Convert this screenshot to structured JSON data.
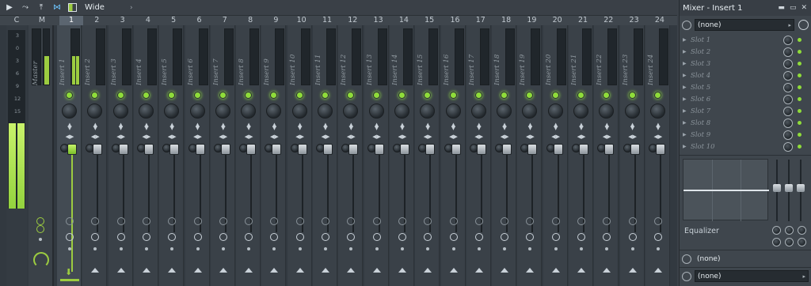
{
  "toolbar": {
    "mode_label": "Wide",
    "icons": [
      "play-arrow-icon",
      "routing-icon",
      "export-icon",
      "link-icon",
      "layout-icon",
      "chevron-right-icon"
    ]
  },
  "mixer": {
    "ruler_labels": [
      "C",
      "M",
      "1",
      "2",
      "3",
      "4",
      "5",
      "6",
      "7",
      "8",
      "9",
      "10",
      "11",
      "12",
      "13",
      "14",
      "15",
      "16",
      "17",
      "18",
      "19",
      "20",
      "21",
      "22",
      "23",
      "24"
    ],
    "meter_scale": [
      "3",
      "0",
      "3",
      "6",
      "9",
      "12",
      "15"
    ],
    "master_label": "Master",
    "inserts": [
      "Insert 1",
      "Insert 2",
      "Insert 3",
      "Insert 4",
      "Insert 5",
      "Insert 6",
      "Insert 7",
      "Insert 8",
      "Insert 9",
      "Insert 10",
      "Insert 11",
      "Insert 12",
      "Insert 13",
      "Insert 14",
      "Insert 15",
      "Insert 16",
      "Insert 17",
      "Insert 18",
      "Insert 19",
      "Insert 20",
      "Insert 21",
      "Insert 22",
      "Insert 23",
      "Insert 24"
    ],
    "selected_insert": "Insert 1",
    "accent_color": "#9ccc40"
  },
  "panel": {
    "title": "Mixer - Insert 1",
    "input_select": "(none)",
    "slots": [
      "Slot 1",
      "Slot 2",
      "Slot 3",
      "Slot 4",
      "Slot 5",
      "Slot 6",
      "Slot 7",
      "Slot 8",
      "Slot 9",
      "Slot 10"
    ],
    "eq_label": "Equalizer",
    "output_select_1": "(none)",
    "output_select_2": "(none)"
  }
}
